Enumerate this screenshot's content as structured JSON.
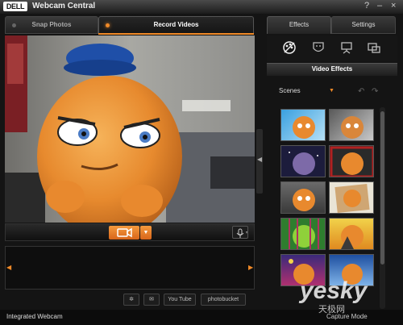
{
  "window": {
    "logo": "DELL",
    "title": "Webcam Central",
    "help_label": "?",
    "minimize_label": "–",
    "close_label": "×"
  },
  "left_tabs": [
    {
      "label": "Snap Photos",
      "active": false
    },
    {
      "label": "Record Videos",
      "active": true
    }
  ],
  "right_tabs": [
    {
      "label": "Effects",
      "active": true
    },
    {
      "label": "Settings",
      "active": false
    }
  ],
  "effect_categories": [
    {
      "icon": "paint-palette-icon"
    },
    {
      "icon": "avatar-mask-icon"
    },
    {
      "icon": "presentation-icon"
    },
    {
      "icon": "picture-in-picture-icon"
    }
  ],
  "effects_panel": {
    "header": "Video Effects",
    "scene_select_value": "Scenes"
  },
  "controls": {
    "record_icon": "video-camera-icon",
    "dropdown_icon": "chevron-down-icon",
    "mic_icon": "microphone-icon"
  },
  "share_buttons": [
    {
      "icon": "effects-icon",
      "label": ""
    },
    {
      "icon": "email-icon",
      "label": ""
    },
    {
      "icon": "youtube-icon",
      "label": "You Tube"
    },
    {
      "icon": "photobucket-icon",
      "label": "photobucket"
    }
  ],
  "status": {
    "left": "Integrated Webcam",
    "right": "Capture Mode"
  },
  "watermark": {
    "text": "yesky",
    "sub": "天极网"
  },
  "colors": {
    "accent": "#f08a28",
    "background": "#141414",
    "panel": "#1c1c1c"
  }
}
